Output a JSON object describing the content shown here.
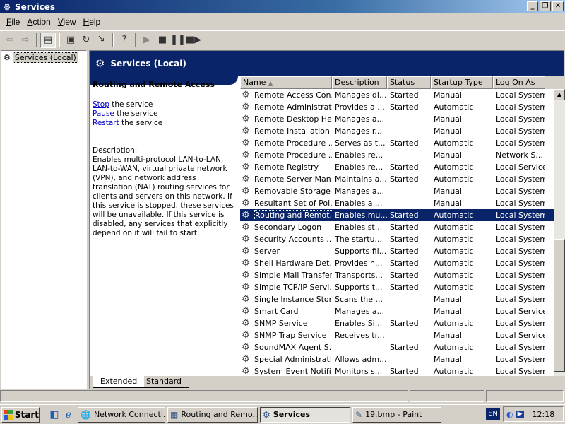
{
  "window": {
    "title": "Services"
  },
  "menu": [
    {
      "key": "F",
      "rest": "ile"
    },
    {
      "key": "A",
      "rest": "ction"
    },
    {
      "key": "V",
      "rest": "iew"
    },
    {
      "key": "H",
      "rest": "elp"
    }
  ],
  "tree": {
    "root_label": "Services (Local)"
  },
  "banner": {
    "title": "Services (Local)"
  },
  "detail": {
    "service_name": "Routing and Remote Access",
    "stop_link": "Stop",
    "stop_rest": " the service",
    "pause_link": "Pause",
    "pause_rest": " the service",
    "restart_link": "Restart",
    "restart_rest": " the service",
    "description_label": "Description:",
    "description_text": "Enables multi-protocol LAN-to-LAN, LAN-to-WAN, virtual private network (VPN), and network address translation (NAT) routing services for clients and servers on this network. If this service is stopped, these services will be unavailable. If this service is disabled, any services that explicitly depend on it will fail to start."
  },
  "columns": {
    "name": "Name",
    "description": "Description",
    "status": "Status",
    "startup": "Startup Type",
    "logon": "Log On As"
  },
  "services": [
    {
      "name": "Remote Access Con...",
      "description": "Manages di...",
      "status": "Started",
      "startup": "Manual",
      "logon": "Local System"
    },
    {
      "name": "Remote Administrati...",
      "description": "Provides a ...",
      "status": "Started",
      "startup": "Automatic",
      "logon": "Local System"
    },
    {
      "name": "Remote Desktop He...",
      "description": "Manages a...",
      "status": "",
      "startup": "Manual",
      "logon": "Local System"
    },
    {
      "name": "Remote Installation",
      "description": "Manages r...",
      "status": "",
      "startup": "Manual",
      "logon": "Local System"
    },
    {
      "name": "Remote Procedure ...",
      "description": "Serves as t...",
      "status": "Started",
      "startup": "Automatic",
      "logon": "Local System"
    },
    {
      "name": "Remote Procedure ...",
      "description": "Enables re...",
      "status": "",
      "startup": "Manual",
      "logon": "Network S..."
    },
    {
      "name": "Remote Registry",
      "description": "Enables re...",
      "status": "Started",
      "startup": "Automatic",
      "logon": "Local Service"
    },
    {
      "name": "Remote Server Man...",
      "description": "Maintains a...",
      "status": "Started",
      "startup": "Automatic",
      "logon": "Local System"
    },
    {
      "name": "Removable Storage",
      "description": "Manages a...",
      "status": "",
      "startup": "Manual",
      "logon": "Local System"
    },
    {
      "name": "Resultant Set of Pol...",
      "description": "Enables a ...",
      "status": "",
      "startup": "Manual",
      "logon": "Local System"
    },
    {
      "name": "Routing and Remot...",
      "description": "Enables mu...",
      "status": "Started",
      "startup": "Automatic",
      "logon": "Local System"
    },
    {
      "name": "Secondary Logon",
      "description": "Enables st...",
      "status": "Started",
      "startup": "Automatic",
      "logon": "Local System"
    },
    {
      "name": "Security Accounts ...",
      "description": "The startu...",
      "status": "Started",
      "startup": "Automatic",
      "logon": "Local System"
    },
    {
      "name": "Server",
      "description": "Supports fil...",
      "status": "Started",
      "startup": "Automatic",
      "logon": "Local System"
    },
    {
      "name": "Shell Hardware Det...",
      "description": "Provides n...",
      "status": "Started",
      "startup": "Automatic",
      "logon": "Local System"
    },
    {
      "name": "Simple Mail Transfer...",
      "description": "Transports...",
      "status": "Started",
      "startup": "Automatic",
      "logon": "Local System"
    },
    {
      "name": "Simple TCP/IP Servi...",
      "description": "Supports t...",
      "status": "Started",
      "startup": "Automatic",
      "logon": "Local System"
    },
    {
      "name": "Single Instance Stor...",
      "description": "Scans the ...",
      "status": "",
      "startup": "Manual",
      "logon": "Local System"
    },
    {
      "name": "Smart Card",
      "description": "Manages a...",
      "status": "",
      "startup": "Manual",
      "logon": "Local Service"
    },
    {
      "name": "SNMP Service",
      "description": "Enables Si...",
      "status": "Started",
      "startup": "Automatic",
      "logon": "Local System"
    },
    {
      "name": "SNMP Trap Service",
      "description": "Receives tr...",
      "status": "",
      "startup": "Manual",
      "logon": "Local Service"
    },
    {
      "name": "SoundMAX Agent S...",
      "description": "",
      "status": "Started",
      "startup": "Automatic",
      "logon": "Local System"
    },
    {
      "name": "Special Administrati...",
      "description": "Allows adm...",
      "status": "",
      "startup": "Manual",
      "logon": "Local System"
    },
    {
      "name": "System Event Notifi...",
      "description": "Monitors s...",
      "status": "Started",
      "startup": "Automatic",
      "logon": "Local System"
    }
  ],
  "selected_index": 10,
  "tabs": {
    "extended": "Extended",
    "standard": "Standard"
  },
  "taskbar": {
    "start_label": "Start",
    "tasks": [
      {
        "label": "Network Connecti...",
        "active": false
      },
      {
        "label": "Routing and Remo...",
        "active": false
      },
      {
        "label": "Services",
        "active": true
      },
      {
        "label": "19.bmp - Paint",
        "active": false
      }
    ],
    "language": "EN",
    "clock": "12:18"
  },
  "colors": {
    "selection": "#0a246a",
    "link": "#0000cc",
    "banner": "#0a246a"
  }
}
